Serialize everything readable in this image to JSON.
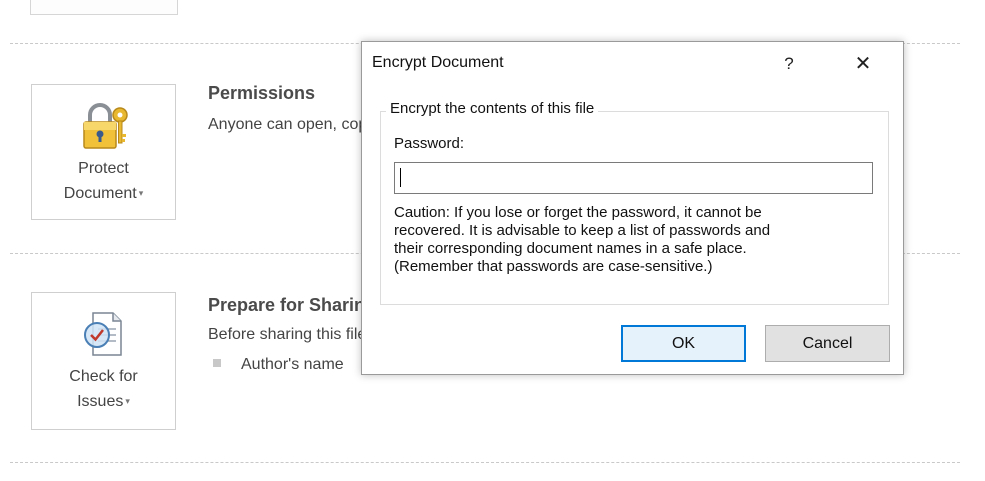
{
  "backstage": {
    "protect_button": {
      "line1": "Protect",
      "line2": "Document",
      "icon": "lock-key-icon"
    },
    "check_button": {
      "line1": "Check for",
      "line2": "Issues",
      "icon": "inspect-document-icon"
    },
    "dropdown_glyph": "▾",
    "permissions": {
      "title": "Permissions",
      "text": "Anyone can open, copy, and change any part of this document."
    },
    "prepare": {
      "title": "Prepare for Sharing",
      "text": "Before sharing this file, be aware that it contains:",
      "bullets": [
        "Author's name"
      ]
    }
  },
  "dialog": {
    "title": "Encrypt Document",
    "help_glyph": "?",
    "close_glyph": "✕",
    "group_label": "Encrypt the contents of this file",
    "password_label": "Password:",
    "password_value": "",
    "caution_lines": [
      "Caution: If you lose or forget the password, it cannot be",
      "recovered. It is advisable to keep a list of passwords and",
      "their corresponding document names in a safe place.",
      "(Remember that passwords are case-sensitive.)"
    ],
    "ok_label": "OK",
    "cancel_label": "Cancel"
  },
  "colors": {
    "dialog_default_button_border": "#0078d7",
    "dialog_default_button_fill": "#e5f1fb",
    "button_fill": "#e1e1e1",
    "separator": "#c9c9c9"
  }
}
